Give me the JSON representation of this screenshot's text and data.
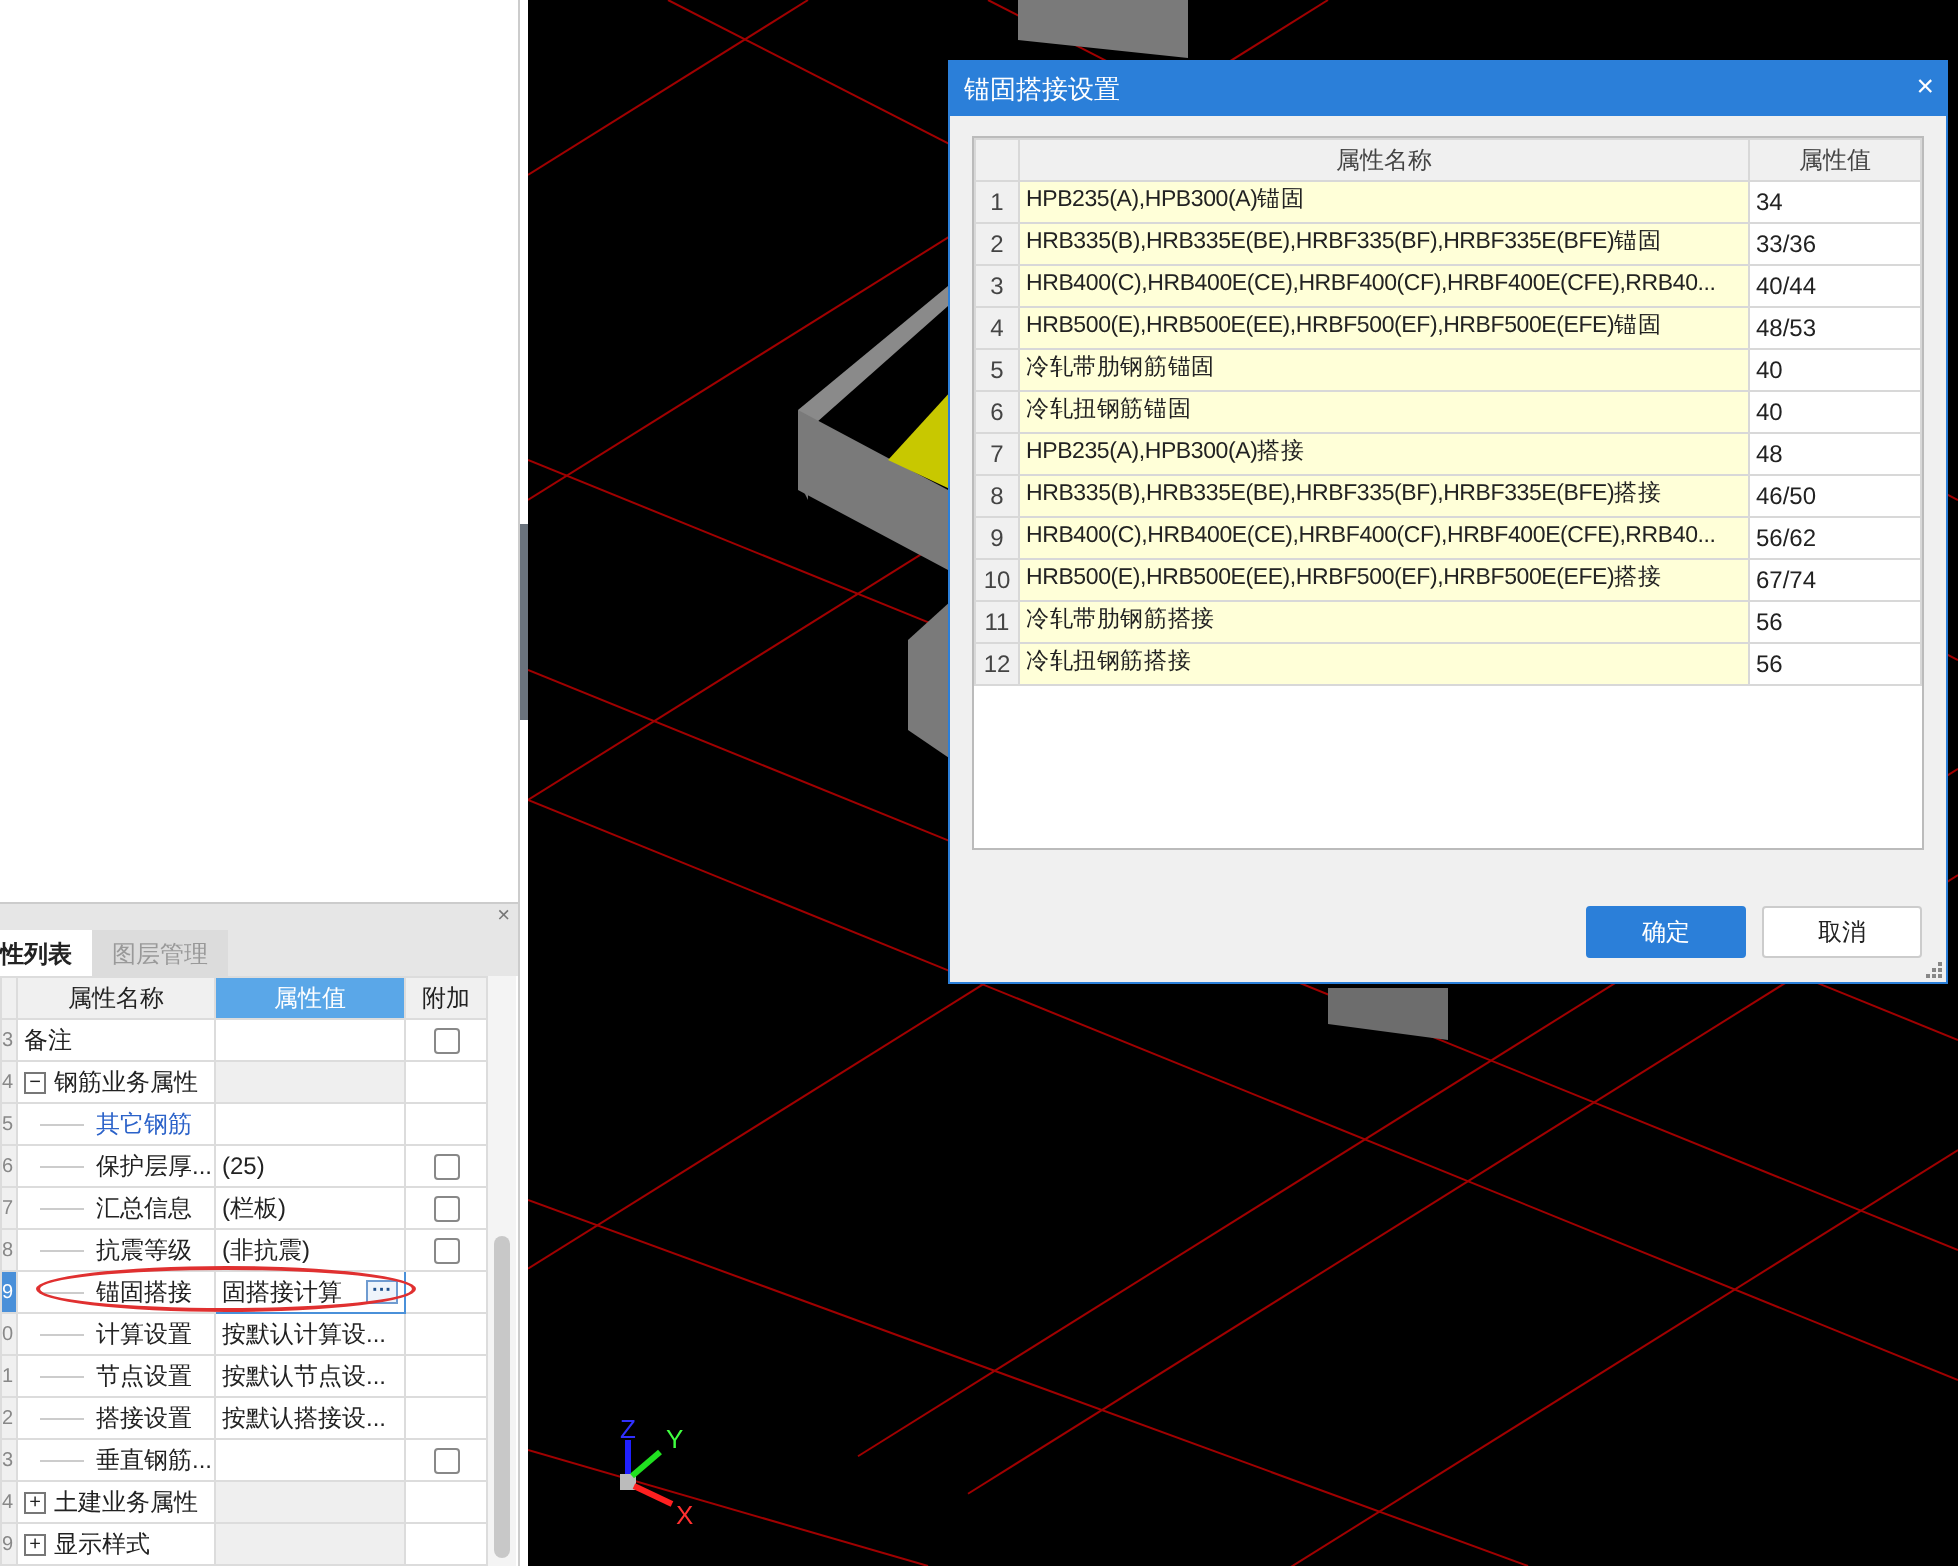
{
  "property_panel": {
    "close": "×",
    "tabs": [
      {
        "label": "性列表",
        "selected": true
      },
      {
        "label": "图层管理",
        "selected": false
      }
    ],
    "columns": [
      "属性名称",
      "属性值",
      "附加"
    ],
    "rows": [
      {
        "num": "3",
        "name": "备注",
        "checked": false,
        "selected": false
      },
      {
        "num": "4",
        "name": "钢筋业务属性",
        "kind": "group",
        "expander": "−",
        "selected": false,
        "children": [
          {
            "num": "5",
            "name": "其它钢筋",
            "kind": "link",
            "selected": false
          },
          {
            "num": "6",
            "name": "保护层厚...",
            "value": "(25)",
            "checked": false,
            "selected": false
          },
          {
            "num": "7",
            "name": "汇总信息",
            "value": "(栏板)",
            "checked": false,
            "selected": false
          },
          {
            "num": "8",
            "name": "抗震等级",
            "value": "(非抗震)",
            "checked": false,
            "selected": false
          },
          {
            "num": "9",
            "name": "锚固搭接",
            "value": "固搭接计算",
            "button": "···",
            "selected": true
          },
          {
            "num": "0",
            "name": "计算设置",
            "value": "按默认计算设...",
            "selected": false
          },
          {
            "num": "1",
            "name": "节点设置",
            "value": "按默认节点设...",
            "selected": false
          },
          {
            "num": "2",
            "name": "搭接设置",
            "value": "按默认搭接设...",
            "selected": false
          },
          {
            "num": "3",
            "name": "垂直钢筋...",
            "checked": false,
            "selected": false
          }
        ]
      },
      {
        "num": "4",
        "name": "土建业务属性",
        "kind": "group",
        "expander": "+",
        "selected": false
      },
      {
        "num": "9",
        "name": "显示样式",
        "kind": "group",
        "expander": "+",
        "selected": false
      }
    ]
  },
  "viewport": {
    "axes": [
      "Z",
      "Y",
      "X"
    ]
  },
  "dialog": {
    "title": "锚固搭接设置",
    "close": "×",
    "columns": [
      "属性名称",
      "属性值"
    ],
    "rows": [
      {
        "num": "1",
        "name": "HPB235(A),HPB300(A)锚固",
        "value": "34"
      },
      {
        "num": "2",
        "name": "HRB335(B),HRB335E(BE),HRBF335(BF),HRBF335E(BFE)锚固",
        "value": "33/36"
      },
      {
        "num": "3",
        "name": "HRB400(C),HRB400E(CE),HRBF400(CF),HRBF400E(CFE),RRB40...",
        "value": "40/44"
      },
      {
        "num": "4",
        "name": "HRB500(E),HRB500E(EE),HRBF500(EF),HRBF500E(EFE)锚固",
        "value": "48/53"
      },
      {
        "num": "5",
        "name": "冷轧带肋钢筋锚固",
        "value": "40"
      },
      {
        "num": "6",
        "name": "冷轧扭钢筋锚固",
        "value": "40"
      },
      {
        "num": "7",
        "name": "HPB235(A),HPB300(A)搭接",
        "value": "48"
      },
      {
        "num": "8",
        "name": "HRB335(B),HRB335E(BE),HRBF335(BF),HRBF335E(BFE)搭接",
        "value": "46/50"
      },
      {
        "num": "9",
        "name": "HRB400(C),HRB400E(CE),HRBF400(CF),HRBF400E(CFE),RRB40...",
        "value": "56/62"
      },
      {
        "num": "10",
        "name": "HRB500(E),HRB500E(EE),HRBF500(EF),HRBF500E(EFE)搭接",
        "value": "67/74"
      },
      {
        "num": "11",
        "name": "冷轧带肋钢筋搭接",
        "value": "56"
      },
      {
        "num": "12",
        "name": "冷轧扭钢筋搭接",
        "value": "56"
      }
    ],
    "buttons": [
      {
        "label": "确定",
        "kind": "primary"
      },
      {
        "label": "取消",
        "kind": "secondary"
      }
    ]
  }
}
